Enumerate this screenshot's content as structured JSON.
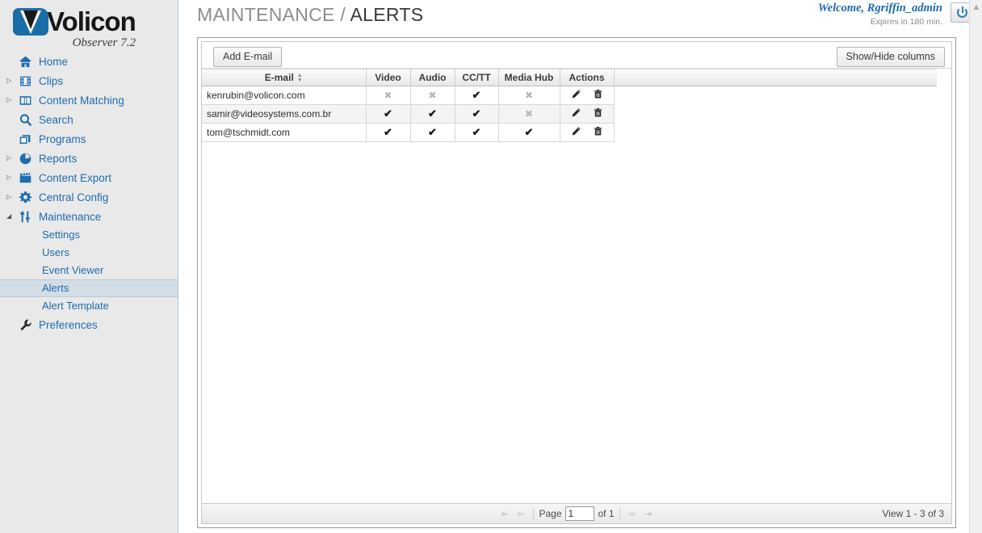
{
  "brand": {
    "name": "Volicon",
    "product": "Observer 7.2",
    "logo_icon": "volicon-v-logo"
  },
  "header": {
    "breadcrumb_parent": "MAINTENANCE",
    "breadcrumb_sep": "/",
    "breadcrumb_current": "ALERTS",
    "welcome": "Welcome, Rgriffin_admin",
    "expires": "Expires in 180 min.",
    "logout_icon": "power-icon"
  },
  "sidebar": {
    "items": [
      {
        "label": "Home",
        "icon": "home-icon",
        "expandable": false,
        "expanded": false
      },
      {
        "label": "Clips",
        "icon": "film-strip-icon",
        "expandable": true,
        "expanded": false
      },
      {
        "label": "Content Matching",
        "icon": "content-matching-icon",
        "expandable": true,
        "expanded": false
      },
      {
        "label": "Search",
        "icon": "magnifier-icon",
        "expandable": false,
        "expanded": false
      },
      {
        "label": "Programs",
        "icon": "programs-icon",
        "expandable": false,
        "expanded": false
      },
      {
        "label": "Reports",
        "icon": "pie-chart-icon",
        "expandable": true,
        "expanded": false
      },
      {
        "label": "Content Export",
        "icon": "clapperboard-icon",
        "expandable": true,
        "expanded": false
      },
      {
        "label": "Central Config",
        "icon": "gear-icon",
        "expandable": true,
        "expanded": false
      },
      {
        "label": "Maintenance",
        "icon": "sliders-icon",
        "expandable": true,
        "expanded": true
      },
      {
        "label": "Preferences",
        "icon": "wrench-icon",
        "expandable": false,
        "expanded": false
      }
    ],
    "maintenance_children": [
      {
        "label": "Settings",
        "active": false
      },
      {
        "label": "Users",
        "active": false
      },
      {
        "label": "Event Viewer",
        "active": false
      },
      {
        "label": "Alerts",
        "active": true
      },
      {
        "label": "Alert Template",
        "active": false
      }
    ]
  },
  "toolbar": {
    "add_email_label": "Add E-mail",
    "show_hide_label": "Show/Hide columns"
  },
  "table": {
    "columns": [
      "E-mail",
      "Video",
      "Audio",
      "CC/TT",
      "Media Hub",
      "Actions"
    ],
    "sort_column": "E-mail",
    "sort_indicator": "both-arrows",
    "rows": [
      {
        "email": "kenrubin@volicon.com",
        "video": false,
        "audio": false,
        "cctt": true,
        "media_hub": false,
        "actions": [
          "edit-icon",
          "delete-icon"
        ]
      },
      {
        "email": "samir@videosystems.com.br",
        "video": true,
        "audio": true,
        "cctt": true,
        "media_hub": false,
        "actions": [
          "edit-icon",
          "delete-icon"
        ]
      },
      {
        "email": "tom@tschmidt.com",
        "video": true,
        "audio": true,
        "cctt": true,
        "media_hub": true,
        "actions": [
          "edit-icon",
          "delete-icon"
        ]
      }
    ],
    "yes_glyph": "✔",
    "no_glyph": "✖"
  },
  "footer": {
    "first_page_label": "⏪",
    "prev_page_label": "◀",
    "next_page_label": "▶",
    "last_page_label": "⏩",
    "page_label": "Page",
    "page_value": "1",
    "of_label": "of 1",
    "view_count": "View 1 - 3 of 3"
  },
  "scrollbar": {
    "up_arrow": "▲"
  },
  "colors": {
    "accent_blue": "#1f6cb0",
    "sidebar_bg": "#e9e9e9",
    "active_item_bg": "#d3dde6",
    "title_gray": "#8d8d8d"
  }
}
